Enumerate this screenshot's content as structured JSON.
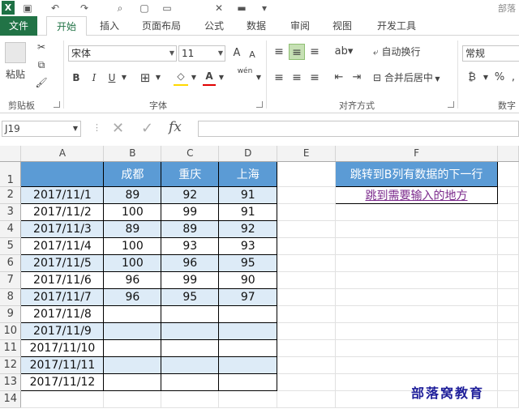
{
  "app": {
    "logo": "X",
    "account": "部落"
  },
  "ribbon_tabs": [
    "文件",
    "开始",
    "插入",
    "页面布局",
    "公式",
    "数据",
    "审阅",
    "视图",
    "开发工具"
  ],
  "clipboard": {
    "paste": "粘贴",
    "group": "剪贴板"
  },
  "font": {
    "name": "宋体",
    "size": "11",
    "group": "字体",
    "bold": "B",
    "italic": "I",
    "underline": "U",
    "grow": "A",
    "shrink": "A",
    "pinyin": "wén"
  },
  "alignment": {
    "wrap": "自动换行",
    "merge": "合并后居中",
    "group": "对齐方式"
  },
  "number": {
    "format": "常规",
    "group": "数字",
    "percent": "%"
  },
  "formula_bar": {
    "name_box": "J19",
    "fx": "fx",
    "value": ""
  },
  "columns": [
    "A",
    "B",
    "C",
    "D",
    "E",
    "F"
  ],
  "rows": [
    "1",
    "2",
    "3",
    "4",
    "5",
    "6",
    "7",
    "8",
    "9",
    "10",
    "11",
    "12",
    "13",
    "14"
  ],
  "table": {
    "headers": [
      "",
      "成都",
      "重庆",
      "上海"
    ],
    "data": [
      [
        "2017/11/1",
        "89",
        "92",
        "91"
      ],
      [
        "2017/11/2",
        "100",
        "99",
        "91"
      ],
      [
        "2017/11/3",
        "89",
        "89",
        "92"
      ],
      [
        "2017/11/4",
        "100",
        "93",
        "93"
      ],
      [
        "2017/11/5",
        "100",
        "96",
        "95"
      ],
      [
        "2017/11/6",
        "96",
        "99",
        "90"
      ],
      [
        "2017/11/7",
        "96",
        "95",
        "97"
      ],
      [
        "2017/11/8",
        "",
        "",
        ""
      ],
      [
        "2017/11/9",
        "",
        "",
        ""
      ],
      [
        "2017/11/10",
        "",
        "",
        ""
      ],
      [
        "2017/11/11",
        "",
        "",
        ""
      ],
      [
        "2017/11/12",
        "",
        "",
        ""
      ]
    ]
  },
  "side_panel": {
    "title": "跳转到B列有数据的下一行",
    "link": "跳到需要输入的地方"
  },
  "watermark": "部落窝教育",
  "colors": {
    "header_fill": "#5b9bd5",
    "band_fill": "#ddebf7",
    "excel_green": "#217346",
    "link": "#7b2a8c"
  }
}
